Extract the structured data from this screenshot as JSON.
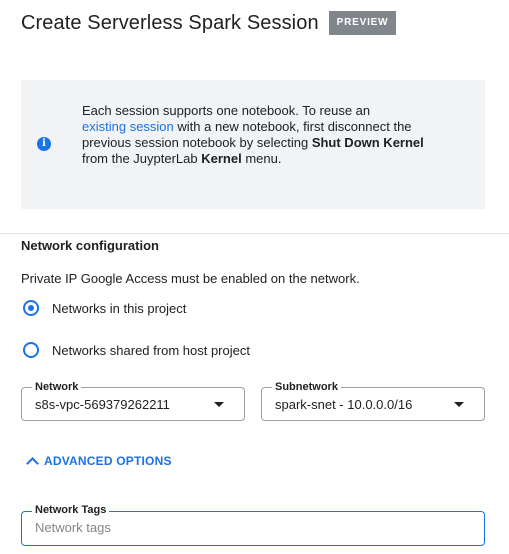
{
  "header": {
    "title": "Create Serverless Spark Session",
    "badge": "PREVIEW"
  },
  "info": {
    "icon": "info-icon",
    "text_1": "Each session supports one notebook. To reuse an",
    "link": "existing session",
    "text_2": " with a new notebook, first disconnect the previous session notebook by selecting ",
    "bold_1": "Shut Down Kernel",
    "text_3": " from the JuypterLab ",
    "bold_2": "Kernel",
    "text_4": " menu."
  },
  "network_config": {
    "title": "Network configuration",
    "description": "Private IP Google Access must be enabled on the network.",
    "options": [
      {
        "label": "Networks in this project",
        "selected": true
      },
      {
        "label": "Networks shared from host project",
        "selected": false
      }
    ],
    "network": {
      "label": "Network",
      "value": "s8s-vpc-569379262211"
    },
    "subnetwork": {
      "label": "Subnetwork",
      "value": "spark-snet - 10.0.0.0/16"
    }
  },
  "advanced": {
    "label": "ADVANCED OPTIONS",
    "icon": "chevron-up-icon"
  },
  "network_tags": {
    "label": "Network Tags",
    "placeholder": "Network tags",
    "value": ""
  },
  "colors": {
    "accent": "#1a73e8",
    "badge_bg": "#80868b",
    "info_bg": "#f1f3f4"
  }
}
